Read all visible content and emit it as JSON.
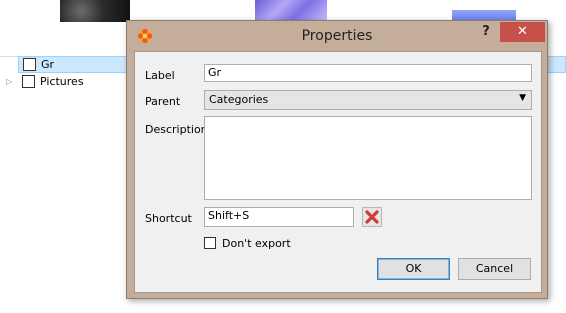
{
  "background_app": {
    "tree": [
      {
        "label": "Gr",
        "selected": true
      },
      {
        "label": "Pictures",
        "selected": false
      }
    ]
  },
  "dialog": {
    "title": "Properties",
    "help_label": "?",
    "close_label": "✕",
    "label_caption": "Label",
    "label_value": "Gr",
    "parent_caption": "Parent",
    "parent_value": "Categories",
    "description_caption": "Description",
    "description_value": "",
    "shortcut_caption": "Shortcut",
    "shortcut_value": "Shift+S",
    "dont_export_label": "Don't export",
    "ok_label": "OK",
    "cancel_label": "Cancel"
  },
  "colors": {
    "dialog_frame": "#c4ad9a",
    "close_button": "#c7504a",
    "selection": "#cce8ff"
  },
  "icons": {
    "app": "flower-icon",
    "clear_shortcut": "red-x-icon",
    "dropdown": "chevron-down-icon"
  }
}
